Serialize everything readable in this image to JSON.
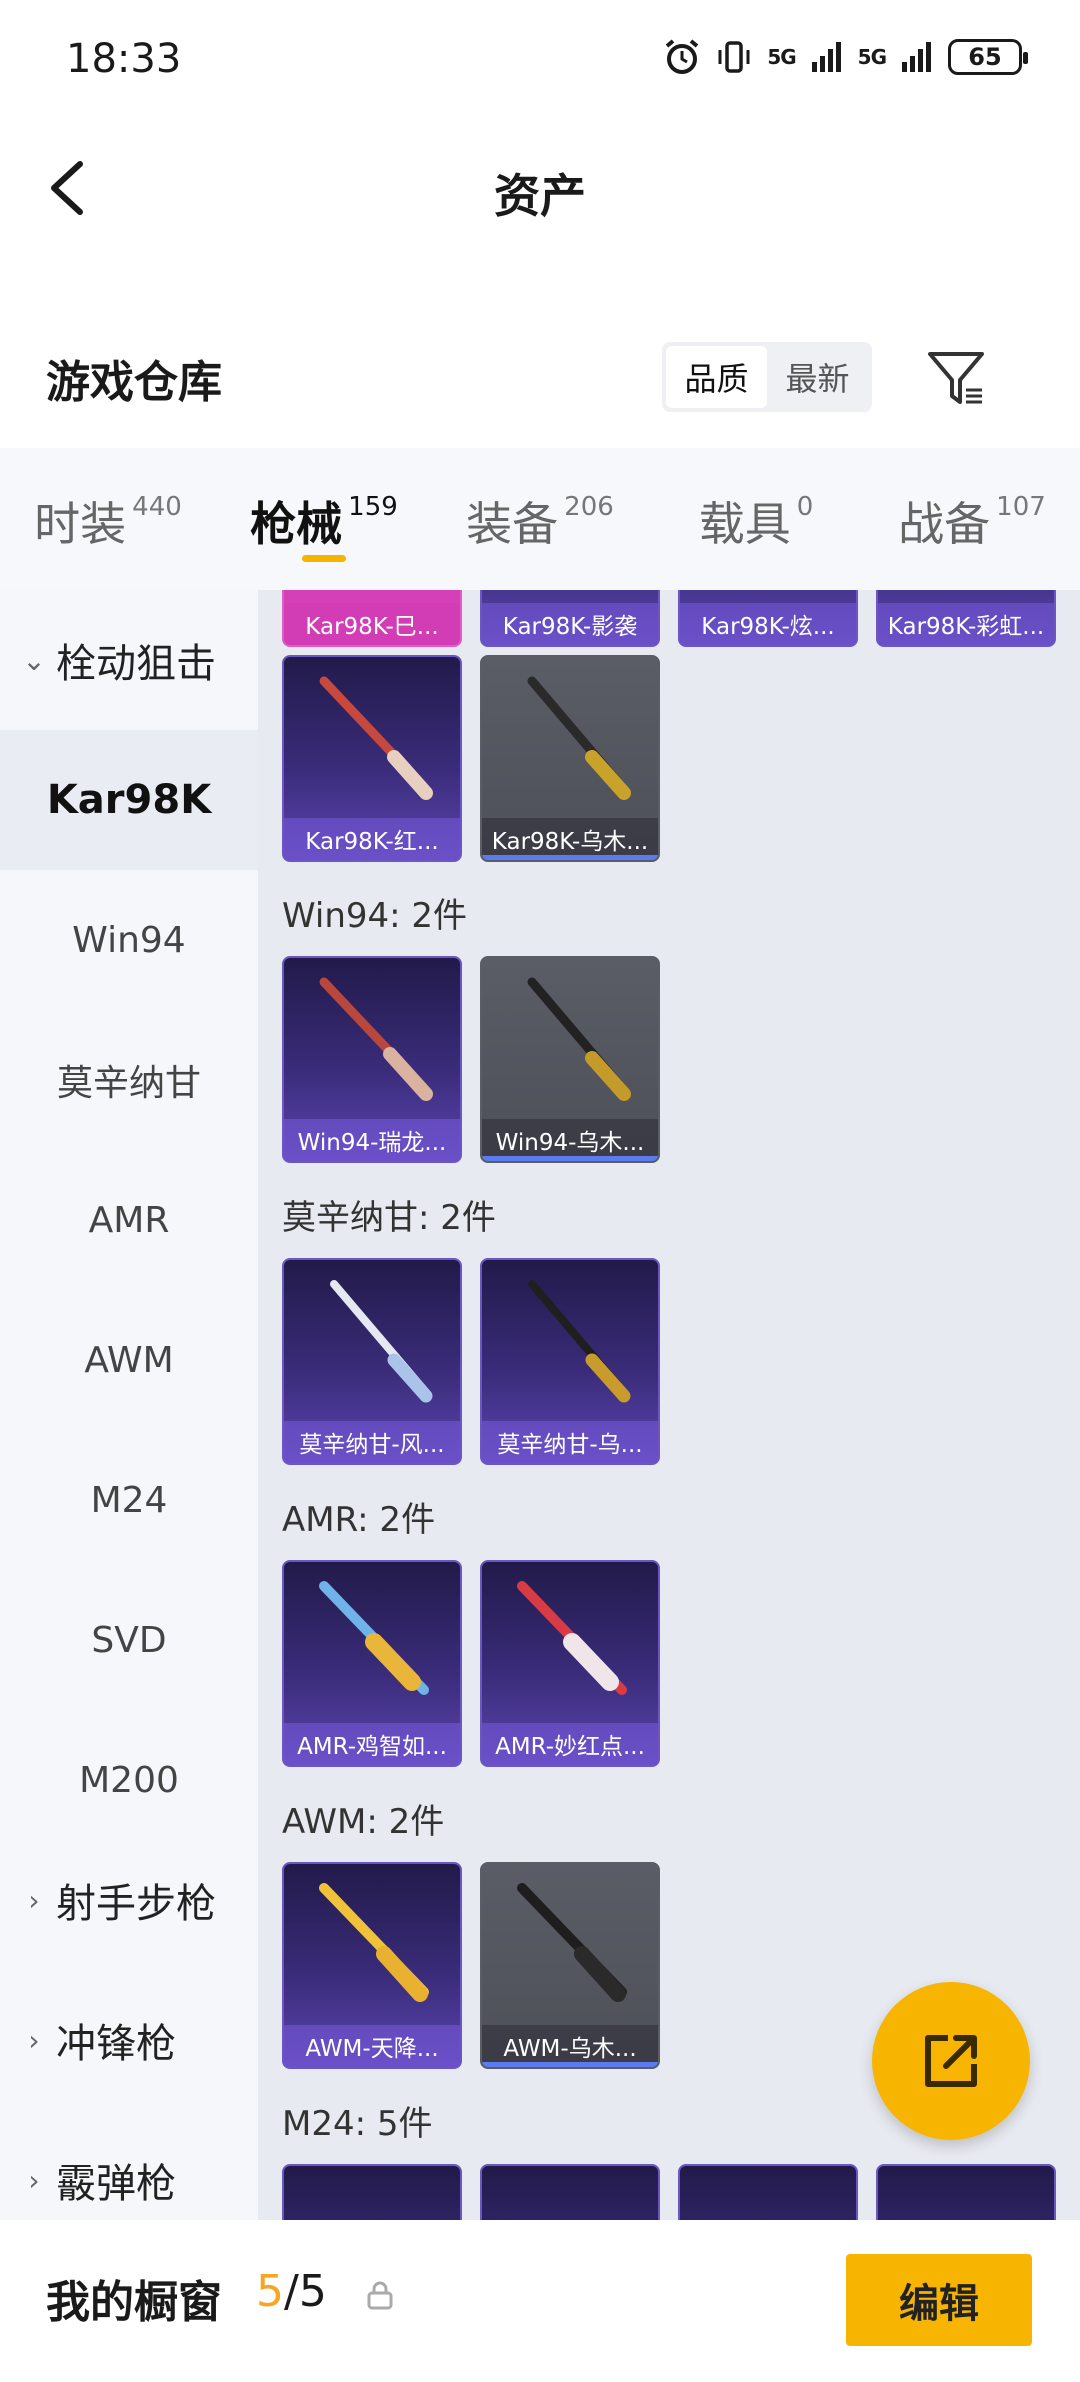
{
  "status_bar": {
    "time": "18:33",
    "signal1": "5G",
    "signal2": "5G",
    "battery": "65"
  },
  "header": {
    "title": "资产"
  },
  "section": {
    "title": "游戏仓库",
    "sort_options": [
      "品质",
      "最新"
    ],
    "active_sort": "品质"
  },
  "tabs": [
    {
      "label": "时装",
      "count": "440"
    },
    {
      "label": "枪械",
      "count": "159"
    },
    {
      "label": "装备",
      "count": "206"
    },
    {
      "label": "载具",
      "count": "0"
    },
    {
      "label": "战备",
      "count": "107"
    }
  ],
  "sidebar": {
    "group_sniper": "栓动狙击",
    "items": [
      "Kar98K",
      "Win94",
      "莫辛纳甘",
      "AMR",
      "AWM",
      "M24",
      "SVD",
      "M200"
    ],
    "group_marksman": "射手步枪",
    "group_smg": "冲锋枪",
    "group_shotgun": "霰弹枪"
  },
  "content": {
    "top_row": [
      "Kar98K-巳...",
      "Kar98K-影袭",
      "Kar98K-炫...",
      "Kar98K-彩虹..."
    ],
    "kar_row": [
      "Kar98K-红...",
      "Kar98K-乌木..."
    ],
    "groups": [
      {
        "label": "Win94: 2件",
        "cards": [
          "Win94-瑞龙...",
          "Win94-乌木..."
        ]
      },
      {
        "label": "莫辛纳甘: 2件",
        "cards": [
          "莫辛纳甘-风...",
          "莫辛纳甘-乌..."
        ]
      },
      {
        "label": "AMR: 2件",
        "cards": [
          "AMR-鸡智如...",
          "AMR-妙红点..."
        ]
      },
      {
        "label": "AWM: 2件",
        "cards": [
          "AWM-天降...",
          "AWM-乌木..."
        ]
      },
      {
        "label": "M24: 5件",
        "cards": []
      }
    ]
  },
  "bottom": {
    "label": "我的橱窗",
    "current": "5",
    "sep": "/",
    "total": "5",
    "edit_label": "编辑"
  }
}
